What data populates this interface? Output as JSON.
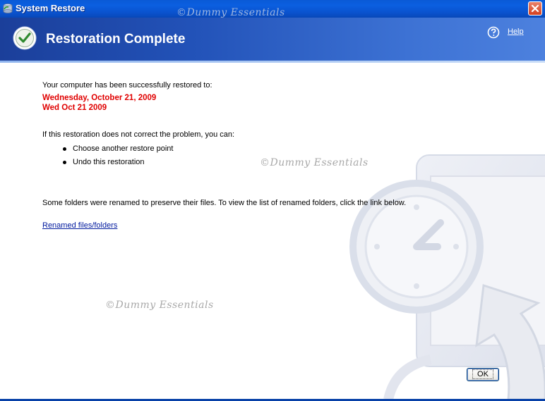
{
  "window": {
    "title": "System Restore",
    "watermark_top": "©Dummy Essentials"
  },
  "header": {
    "heading": "Restoration Complete",
    "help_label": "Help"
  },
  "content": {
    "restored_intro": "Your computer has been successfully restored to:",
    "restore_date_long": "Wednesday, October 21, 2009",
    "restore_date_short": "Wed Oct 21 2009",
    "options_intro": "If this restoration does not correct the problem, you can:",
    "options": [
      "Choose another restore point",
      "Undo this restoration"
    ],
    "renamed_note": "Some folders were renamed to preserve their files. To view the list of renamed folders, click the link below.",
    "renamed_link": "Renamed files/folders",
    "watermark_mid": "©Dummy Essentials",
    "watermark_low": "©Dummy Essentials"
  },
  "buttons": {
    "ok_label": "OK"
  },
  "colors": {
    "title_bar": "#0b5fe0",
    "header": "#2252b8",
    "date_red": "#e00000",
    "link_blue": "#00199e"
  }
}
